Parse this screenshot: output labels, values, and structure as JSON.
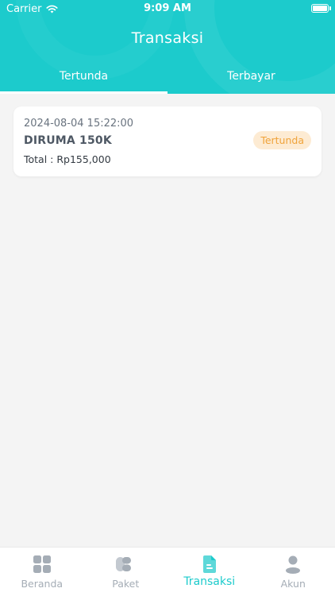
{
  "status_bar": {
    "carrier": "Carrier",
    "time": "9:09 AM"
  },
  "header": {
    "title": "Transaksi"
  },
  "tabs": [
    {
      "label": "Tertunda",
      "active": true
    },
    {
      "label": "Terbayar",
      "active": false
    }
  ],
  "transactions": [
    {
      "date": "2024-08-04 15:22:00",
      "name": "DIRUMA 150K",
      "total": "Total : Rp155,000",
      "status": "Tertunda"
    }
  ],
  "bottom_nav": [
    {
      "label": "Beranda",
      "icon": "grid-icon",
      "active": false
    },
    {
      "label": "Paket",
      "icon": "package-icon",
      "active": false
    },
    {
      "label": "Transaksi",
      "icon": "document-icon",
      "active": true
    },
    {
      "label": "Akun",
      "icon": "user-icon",
      "active": false
    }
  ],
  "colors": {
    "primary": "#1ccbcc",
    "badge_bg": "#fdebd3",
    "badge_text": "#f0a33a",
    "inactive": "#a5adb6"
  }
}
